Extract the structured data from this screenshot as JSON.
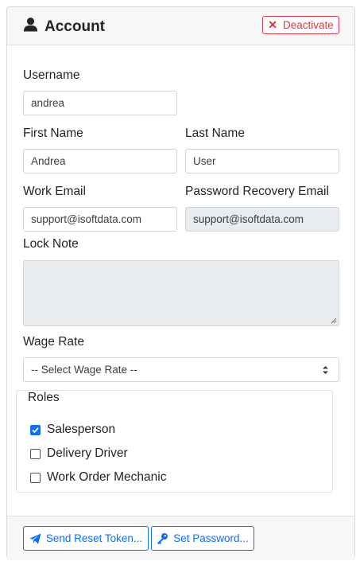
{
  "header": {
    "title": "Account",
    "title_icon": "user-icon",
    "deactivate_label": "Deactivate",
    "deactivate_icon": "x-icon"
  },
  "form": {
    "username": {
      "label": "Username",
      "value": "andrea"
    },
    "first_name": {
      "label": "First Name",
      "value": "Andrea"
    },
    "last_name": {
      "label": "Last Name",
      "value": "User"
    },
    "work_email": {
      "label": "Work Email",
      "value": "support@isoftdata.com"
    },
    "recovery_email": {
      "label": "Password Recovery Email",
      "value": "support@isoftdata.com",
      "disabled": true
    },
    "lock_note": {
      "label": "Lock Note",
      "value": ""
    },
    "wage_rate": {
      "label": "Wage Rate",
      "selected": "-- Select Wage Rate --"
    }
  },
  "roles": {
    "legend": "Roles",
    "items": [
      {
        "label": "Salesperson",
        "checked": true
      },
      {
        "label": "Delivery Driver",
        "checked": false
      },
      {
        "label": "Work Order Mechanic",
        "checked": false
      }
    ]
  },
  "footer": {
    "send_reset_label": "Send Reset Token...",
    "send_reset_icon": "paper-plane-icon",
    "set_password_label": "Set Password...",
    "set_password_icon": "key-icon"
  },
  "colors": {
    "danger": "#dc3545",
    "primary": "#0d6efd",
    "disabled_bg": "#e9ecef"
  }
}
